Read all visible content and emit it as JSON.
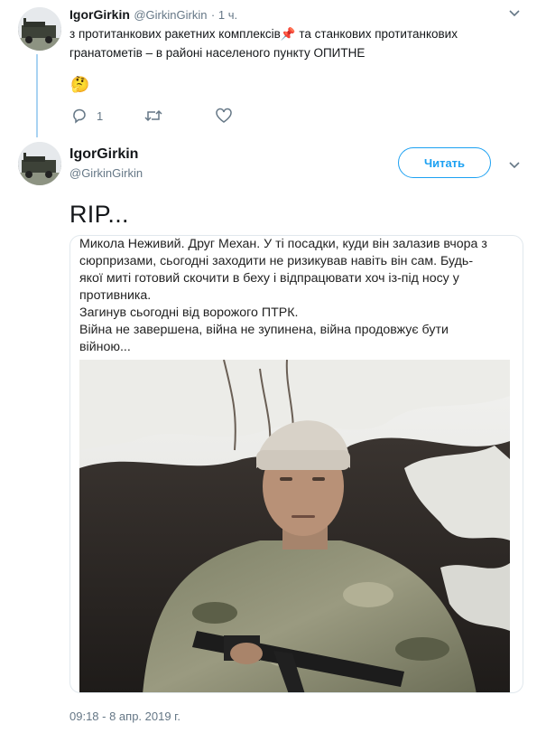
{
  "tweet1": {
    "name": "IgorGirkin",
    "handle": "@GirkinGirkin",
    "time": "· 1 ч.",
    "line1_a": "з протитанкових ракетних комплексів",
    "line1_emoji": "📌",
    "line1_b": " та станкових протитанкових",
    "line2": "гранатометів – в районі населеного пункту ОПИТНЕ",
    "emoji": "🤔",
    "reply_count": "1"
  },
  "tweet2": {
    "name": "IgorGirkin",
    "handle": "@GirkinGirkin",
    "follow_label": "Читать",
    "text": "RIP...",
    "timestamp": "09:18 - 8 апр. 2019 г."
  },
  "card": {
    "lines": [
      "Микола Неживий. Друг Механ. У ті посадки, куди він залазив вчора з",
      "сюрпризами, сьогодні заходити не ризикував навіть він сам. Будь-",
      "якої миті готовий скочити в беху і відпрацювати хоч із-під носу у",
      "противника.",
      "Загинув сьогодні від ворожого ПТРК.",
      "Війна не завершена, війна не зупинена, війна продовжує бути",
      "війною..."
    ]
  },
  "icons": {
    "reply": "reply-icon",
    "retweet": "retweet-icon",
    "like": "heart-icon",
    "more": "chevron-down-icon"
  },
  "colors": {
    "accent": "#1da1f2",
    "thread_line": "#a9d3f2",
    "muted": "#657786"
  }
}
